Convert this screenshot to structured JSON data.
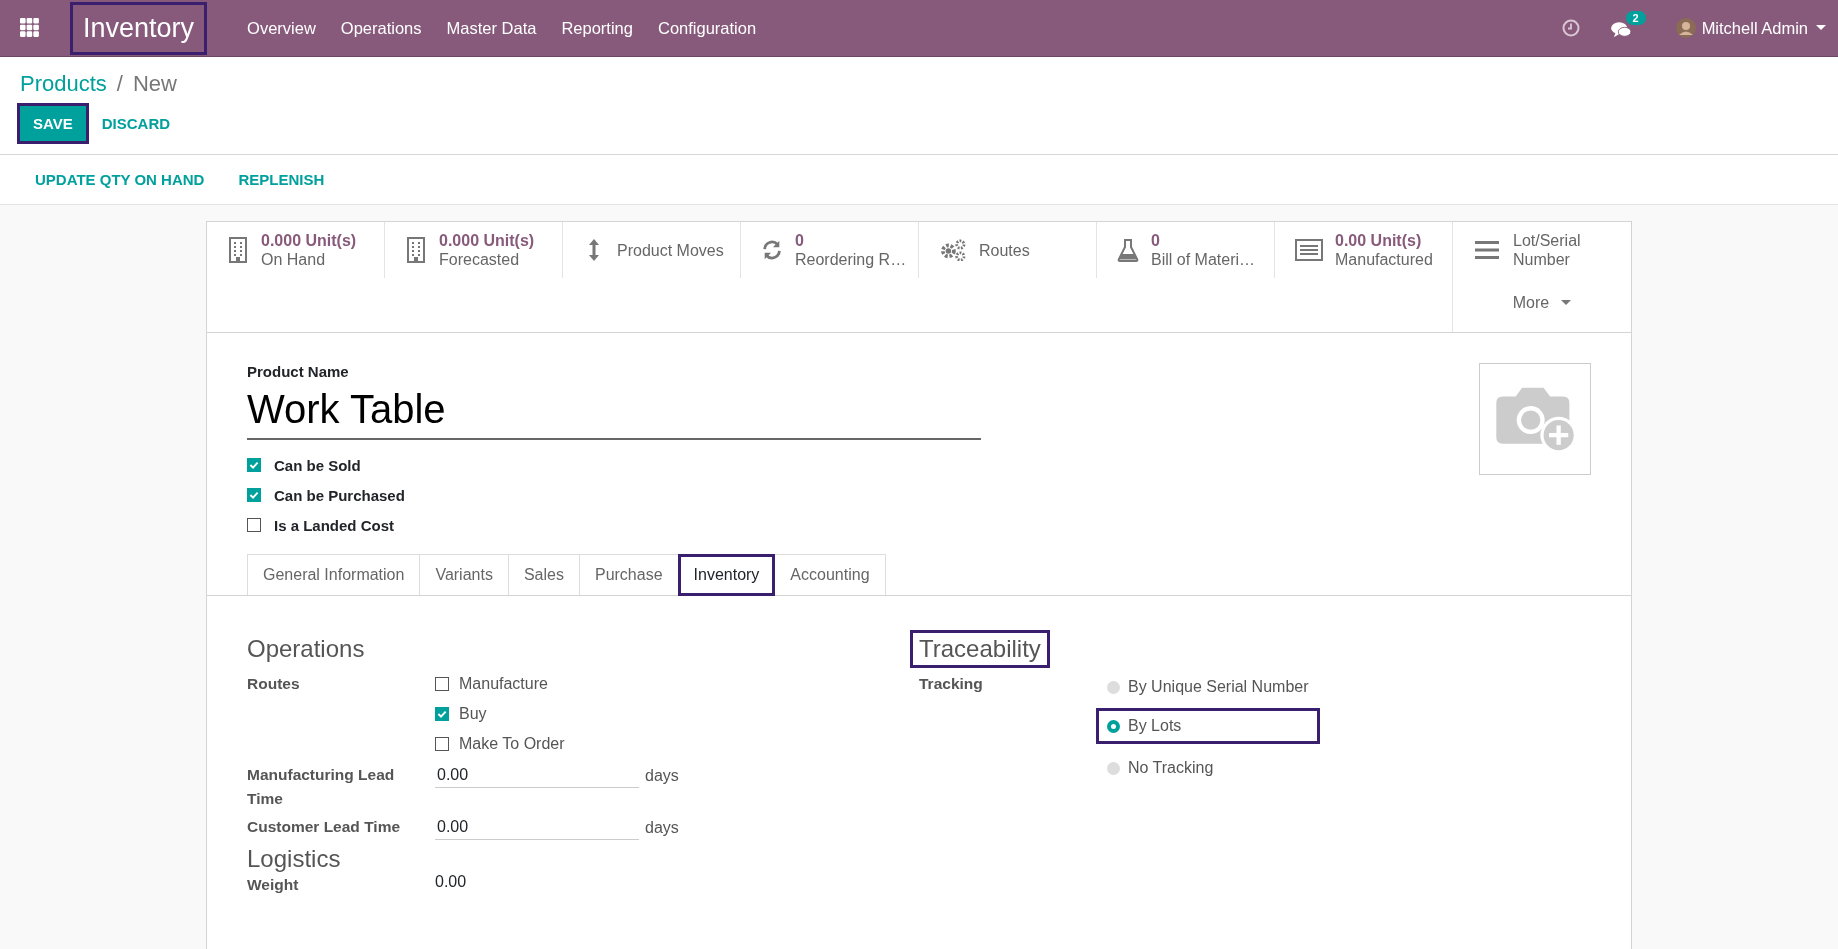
{
  "navbar": {
    "app_name": "Inventory",
    "app_highlighted": true,
    "menu": [
      "Overview",
      "Operations",
      "Master Data",
      "Reporting",
      "Configuration"
    ],
    "chat_count": "2",
    "user": "Mitchell Admin"
  },
  "breadcrumb": {
    "parent": "Products",
    "separator": "/",
    "current": "New"
  },
  "buttons": [
    {
      "label": "SAVE",
      "kind": "primary",
      "highlighted": true
    },
    {
      "label": "DISCARD",
      "kind": "link",
      "highlighted": false
    }
  ],
  "actions": [
    "UPDATE QTY ON HAND",
    "REPLENISH"
  ],
  "stat_buttons": [
    {
      "value": "0.000 Unit(s)",
      "label": "On Hand"
    },
    {
      "value": "0.000 Unit(s)",
      "label": "Forecasted"
    },
    {
      "label": "Product Moves"
    },
    {
      "value": "0",
      "label": "Reordering R…"
    },
    {
      "label": "Routes"
    },
    {
      "value": "0",
      "label": "Bill of Materi…"
    },
    {
      "value": "0.00 Unit(s)",
      "label": "Manufactured"
    },
    {
      "label": "Lot/Serial Number"
    }
  ],
  "more": "More",
  "product": {
    "name_label": "Product Name",
    "name": "Work Table",
    "options": [
      {
        "label": "Can be Sold",
        "checked": true
      },
      {
        "label": "Can be Purchased",
        "checked": true
      },
      {
        "label": "Is a Landed Cost",
        "checked": false
      }
    ]
  },
  "tabs": [
    {
      "label": "General Information",
      "selected": false,
      "highlighted": false
    },
    {
      "label": "Variants",
      "selected": false,
      "highlighted": false
    },
    {
      "label": "Sales",
      "selected": false,
      "highlighted": false
    },
    {
      "label": "Purchase",
      "selected": false,
      "highlighted": false
    },
    {
      "label": "Inventory",
      "selected": true,
      "highlighted": true
    },
    {
      "label": "Accounting",
      "selected": false,
      "highlighted": false
    }
  ],
  "operations": {
    "title": "Operations",
    "routes_label": "Routes",
    "routes": [
      {
        "label": "Manufacture",
        "checked": false
      },
      {
        "label": "Buy",
        "checked": true
      },
      {
        "label": "Make To Order",
        "checked": false
      }
    ],
    "fields": [
      {
        "label": "Manufacturing Lead Time",
        "value": "0.00",
        "unit": "days"
      },
      {
        "label": "Customer Lead Time",
        "value": "0.00",
        "unit": "days"
      }
    ]
  },
  "traceability": {
    "title": "Traceability",
    "highlighted": true,
    "tracking_label": "Tracking",
    "options": [
      {
        "label": "By Unique Serial Number",
        "selected": false,
        "highlighted": false
      },
      {
        "label": "By Lots",
        "selected": true,
        "highlighted": true
      },
      {
        "label": "No Tracking",
        "selected": false,
        "highlighted": false
      }
    ]
  },
  "logistics": {
    "title": "Logistics",
    "fields": [
      {
        "label": "Weight",
        "value": "0.00"
      }
    ]
  }
}
